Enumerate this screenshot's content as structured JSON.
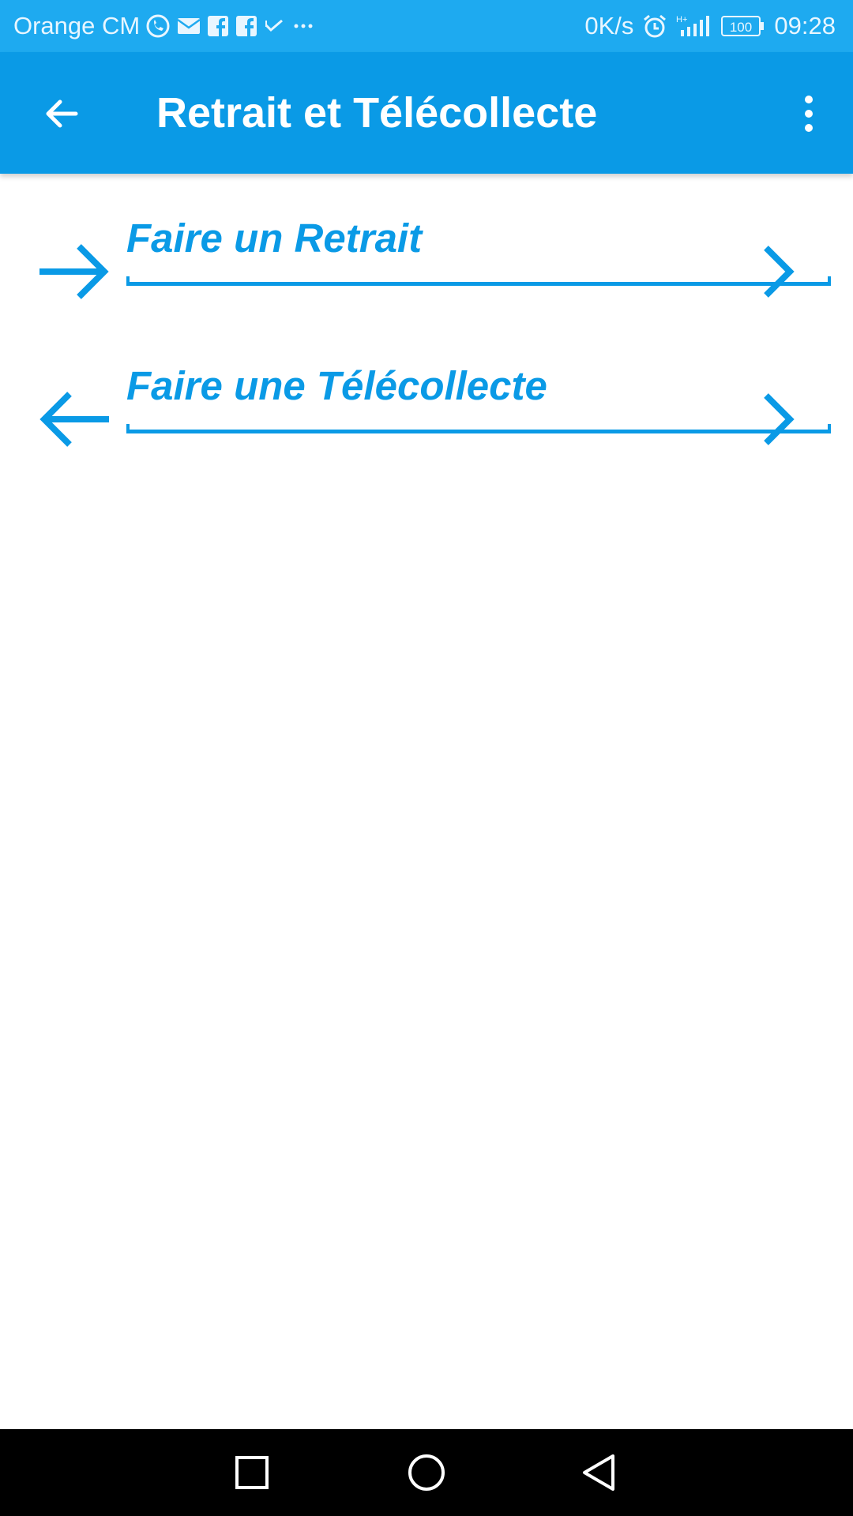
{
  "status_bar": {
    "carrier": "Orange CM",
    "icons_left": [
      "whatsapp-icon",
      "mail-icon",
      "facebook-icon",
      "facebook-icon",
      "check-icon",
      "more-notifications-icon"
    ],
    "speed": "0K/s",
    "icons_right": [
      "alarm-icon",
      "signal-icon",
      "battery-icon"
    ],
    "battery": "100",
    "time": "09:28"
  },
  "app_bar": {
    "title": "Retrait et Télécollecte",
    "back_icon": "arrow-left-icon",
    "overflow_icon": "more-vert-icon"
  },
  "menu": {
    "items": [
      {
        "label": "Faire un Retrait",
        "icon": "arrow-right-icon"
      },
      {
        "label": "Faire une Télécollecte",
        "icon": "arrow-left-icon"
      }
    ]
  },
  "nav_bar": {
    "buttons": [
      "recent-apps-icon",
      "home-icon",
      "back-icon"
    ]
  },
  "colors": {
    "status_bar": "#1eaaf0",
    "app_bar": "#0a9ae6",
    "accent": "#0a9ae6",
    "background": "#ffffff",
    "nav_bar": "#000000"
  }
}
